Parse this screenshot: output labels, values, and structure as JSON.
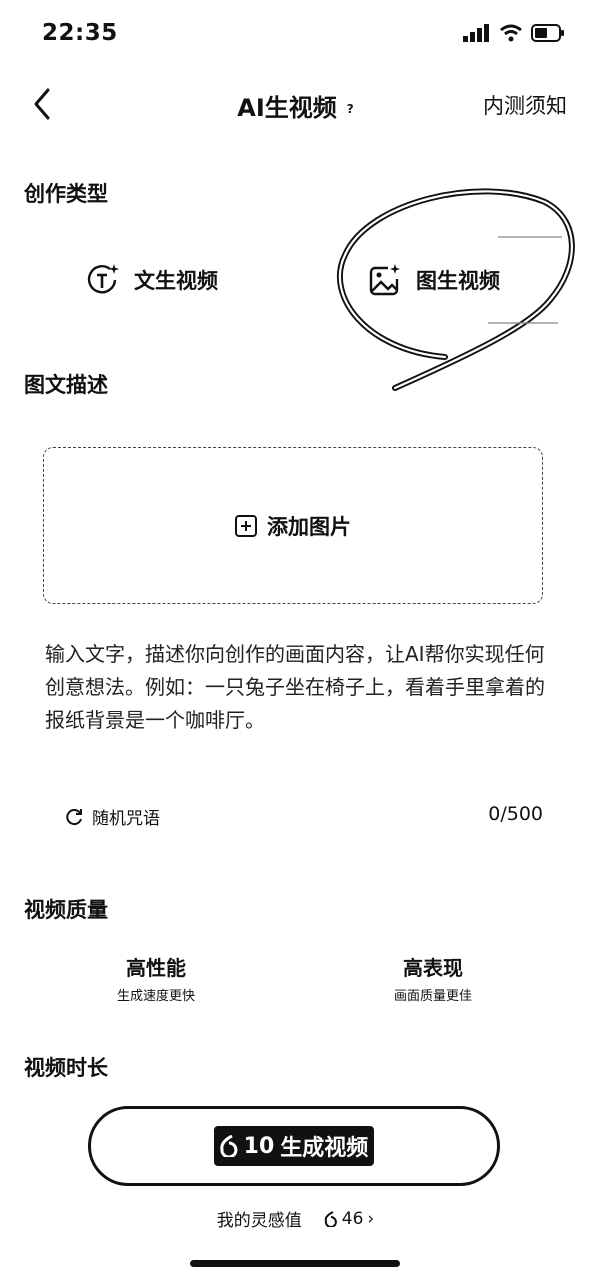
{
  "status_bar": {
    "time": "22:35"
  },
  "nav": {
    "title": "AI生视频",
    "help": "?",
    "right_link": "内测须知"
  },
  "creation_type": {
    "label": "创作类型",
    "options": [
      {
        "label": "文生视频",
        "icon": "text-to-video-icon"
      },
      {
        "label": "图生视频",
        "icon": "image-to-video-icon"
      }
    ]
  },
  "image_text": {
    "label": "图文描述",
    "upload_label": "添加图片",
    "placeholder": "输入文字，描述你向创作的画面内容，让AI帮你实现任何创意想法。例如：一只兔子坐在椅子上，看着手里拿着的报纸背景是一个咖啡厅。",
    "random_label": "随机咒语",
    "counter": "0/500"
  },
  "quality": {
    "label": "视频质量",
    "options": [
      {
        "title": "高性能",
        "subtitle": "生成速度更快"
      },
      {
        "title": "高表现",
        "subtitle": "画面质量更佳"
      }
    ]
  },
  "duration": {
    "label": "视频时长"
  },
  "generate": {
    "cost": "10",
    "label": "生成视频"
  },
  "inspiration": {
    "label": "我的灵感值",
    "value": "46",
    "chevron": "›"
  }
}
